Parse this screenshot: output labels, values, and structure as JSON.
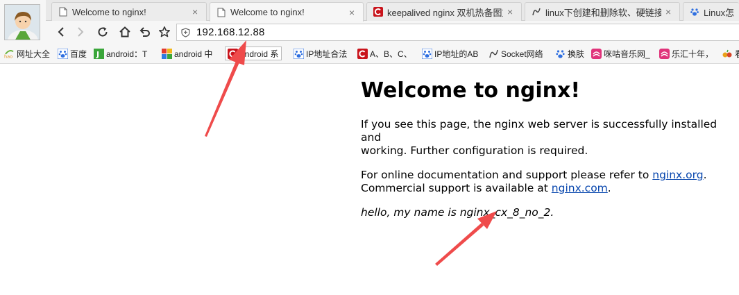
{
  "browser": {
    "tabs": [
      {
        "title": "Welcome to nginx!",
        "close": "×"
      },
      {
        "title": "Welcome to nginx!",
        "close": "×"
      },
      {
        "title": "keepalived nginx 双机热备图文",
        "close": "×"
      },
      {
        "title": "linux下创建和删除软、硬链接 -",
        "close": "×"
      },
      {
        "title": "Linux怎么耳"
      }
    ],
    "address": "192.168.12.88",
    "bookmarks": [
      {
        "label": "网址大全",
        "icon": "hao-icon"
      },
      {
        "label": "百度",
        "icon": "baidu-paw-icon"
      },
      {
        "label": "android：T",
        "icon": "j-icon"
      },
      {
        "label": "android 中",
        "icon": "colorful-grid-icon"
      },
      {
        "label": "android 系",
        "icon": "csdn-c-icon"
      },
      {
        "label": "IP地址合法",
        "icon": "baidu-paw-icon"
      },
      {
        "label": "A、B、C、",
        "icon": "csdn-c-icon"
      },
      {
        "label": "IP地址的AB",
        "icon": "baidu-paw-icon"
      },
      {
        "label": "Socket网络",
        "icon": "ripple-icon"
      },
      {
        "label": "换肤",
        "icon": "baidu-paw-icon"
      },
      {
        "label": "咪咕音乐网_",
        "icon": "migu-icon"
      },
      {
        "label": "乐汇十年，",
        "icon": "migu-icon"
      },
      {
        "label": "看",
        "icon": "fruit-icon"
      }
    ]
  },
  "page": {
    "heading": "Welcome to nginx!",
    "intro_line1": "If you see this page, the nginx web server is successfully installed and",
    "intro_line2": "working. Further configuration is required.",
    "docs_prefix": "For online documentation and support please refer to ",
    "docs_link": "nginx.org",
    "docs_suffix": ".",
    "commercial_prefix": "Commercial support is available at ",
    "commercial_link": "nginx.com",
    "commercial_suffix": ".",
    "custom_message": "hello, my name is nginx_cx_8_no_2."
  },
  "colors": {
    "annotation_arrow": "#ef4b4b",
    "link": "#0645ad"
  }
}
